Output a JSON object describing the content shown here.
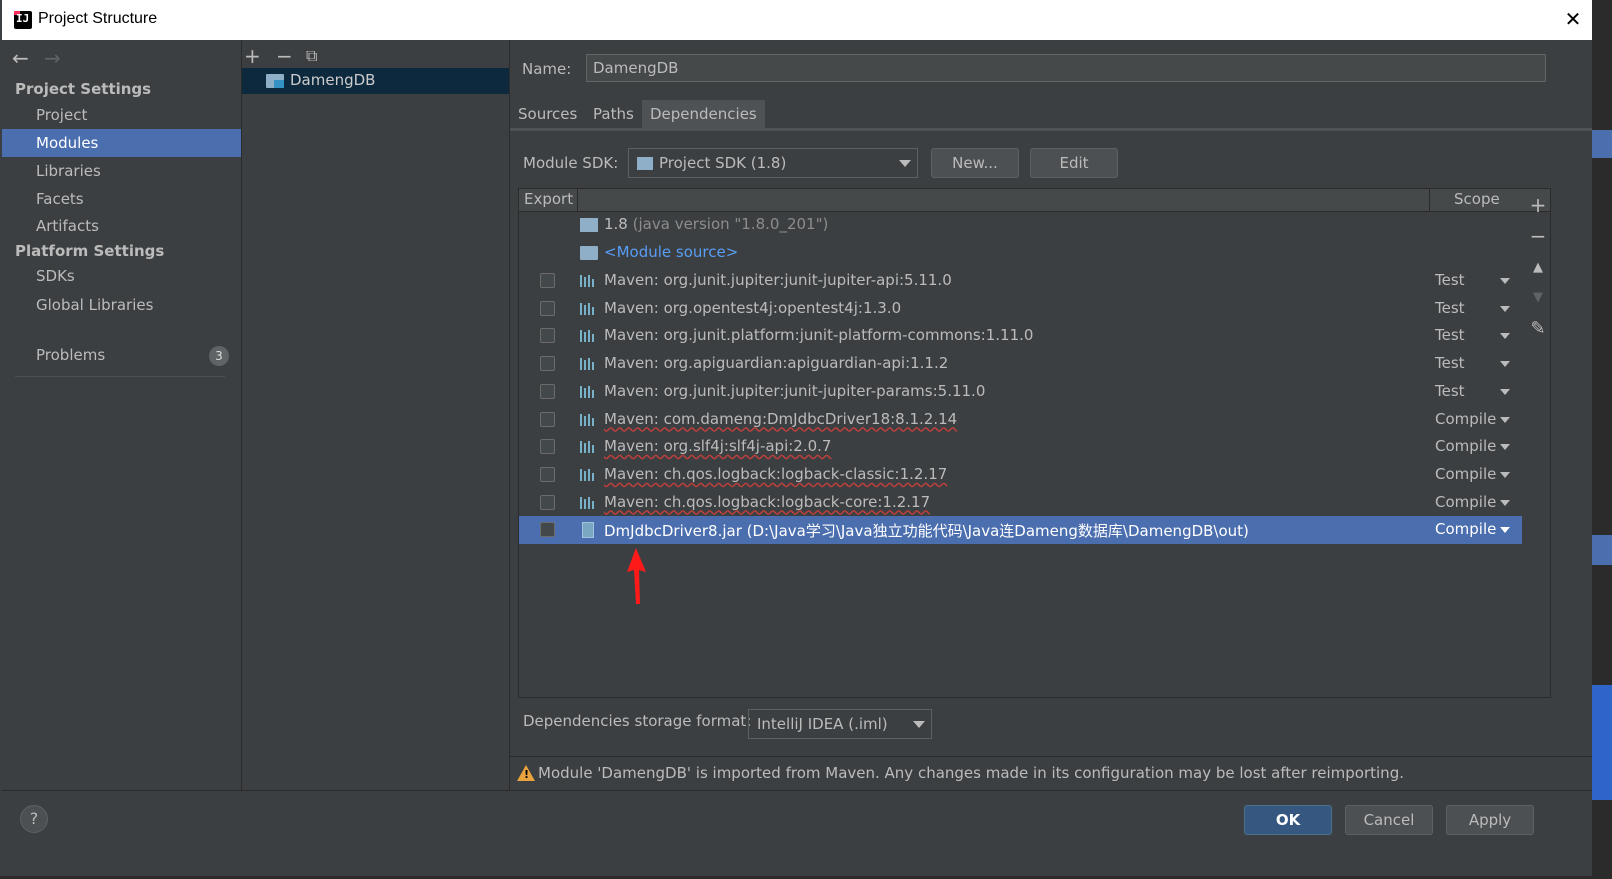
{
  "window": {
    "title": "Project Structure",
    "close": "✕"
  },
  "nav": {
    "back": "←",
    "forward": "→",
    "project_settings": "Project Settings",
    "items_project": [
      {
        "label": "Project"
      },
      {
        "label": "Modules"
      },
      {
        "label": "Libraries"
      },
      {
        "label": "Facets"
      },
      {
        "label": "Artifacts"
      }
    ],
    "platform_settings": "Platform Settings",
    "items_platform": [
      {
        "label": "SDKs"
      },
      {
        "label": "Global Libraries"
      }
    ],
    "problems": {
      "label": "Problems",
      "count": "3"
    }
  },
  "modules": {
    "toolbar": {
      "add": "+",
      "remove": "−",
      "copy": "⧉"
    },
    "items": [
      {
        "label": "DamengDB"
      }
    ]
  },
  "module": {
    "name_label": "Name:",
    "name_value": "DamengDB",
    "tabs": [
      {
        "label": "Sources"
      },
      {
        "label": "Paths"
      },
      {
        "label": "Dependencies"
      }
    ],
    "sdk_label": "Module SDK:",
    "sdk_value": "Project SDK (1.8)",
    "new_button": "New...",
    "edit_button": "Edit",
    "table": {
      "col_export": "Export",
      "col_scope": "Scope",
      "sdk_row": {
        "name": "1.8",
        "detail": "(java version \"1.8.0_201\")"
      },
      "source_row": "<Module source>",
      "rows": [
        {
          "name": "Maven: org.junit.jupiter:junit-jupiter-api:5.11.0",
          "scope": "Test"
        },
        {
          "name": "Maven: org.opentest4j:opentest4j:1.3.0",
          "scope": "Test"
        },
        {
          "name": "Maven: org.junit.platform:junit-platform-commons:1.11.0",
          "scope": "Test"
        },
        {
          "name": "Maven: org.apiguardian:apiguardian-api:1.1.2",
          "scope": "Test"
        },
        {
          "name": "Maven: org.junit.jupiter:junit-jupiter-params:5.11.0",
          "scope": "Test"
        },
        {
          "name": "Maven: com.dameng:DmJdbcDriver18:8.1.2.14",
          "scope": "Compile"
        },
        {
          "name": "Maven: org.slf4j:slf4j-api:2.0.7",
          "scope": "Compile"
        },
        {
          "name": "Maven: ch.qos.logback:logback-classic:1.2.17",
          "scope": "Compile"
        },
        {
          "name": "Maven: ch.qos.logback:logback-core:1.2.17",
          "scope": "Compile"
        },
        {
          "name": "DmJdbcDriver8.jar (D:\\Java学习\\Java独立功能代码\\Java连Dameng数据库\\DamengDB\\out)",
          "scope": "Compile"
        }
      ],
      "side_toolbar": {
        "add": "+",
        "remove": "−",
        "up": "▲",
        "down": "▼",
        "edit": "✎"
      }
    },
    "format_label": "Dependencies storage format:",
    "format_value": "IntelliJ IDEA (.iml)",
    "warning": "Module 'DamengDB' is imported from Maven. Any changes made in its configuration may be lost after reimporting."
  },
  "footer": {
    "help": "?",
    "ok": "OK",
    "cancel": "Cancel",
    "apply": "Apply"
  },
  "colors": {
    "selection": "#4b6eaf",
    "background": "#3c3f41",
    "warning": "#e8a33e",
    "annotation": "#ff1a1a"
  }
}
